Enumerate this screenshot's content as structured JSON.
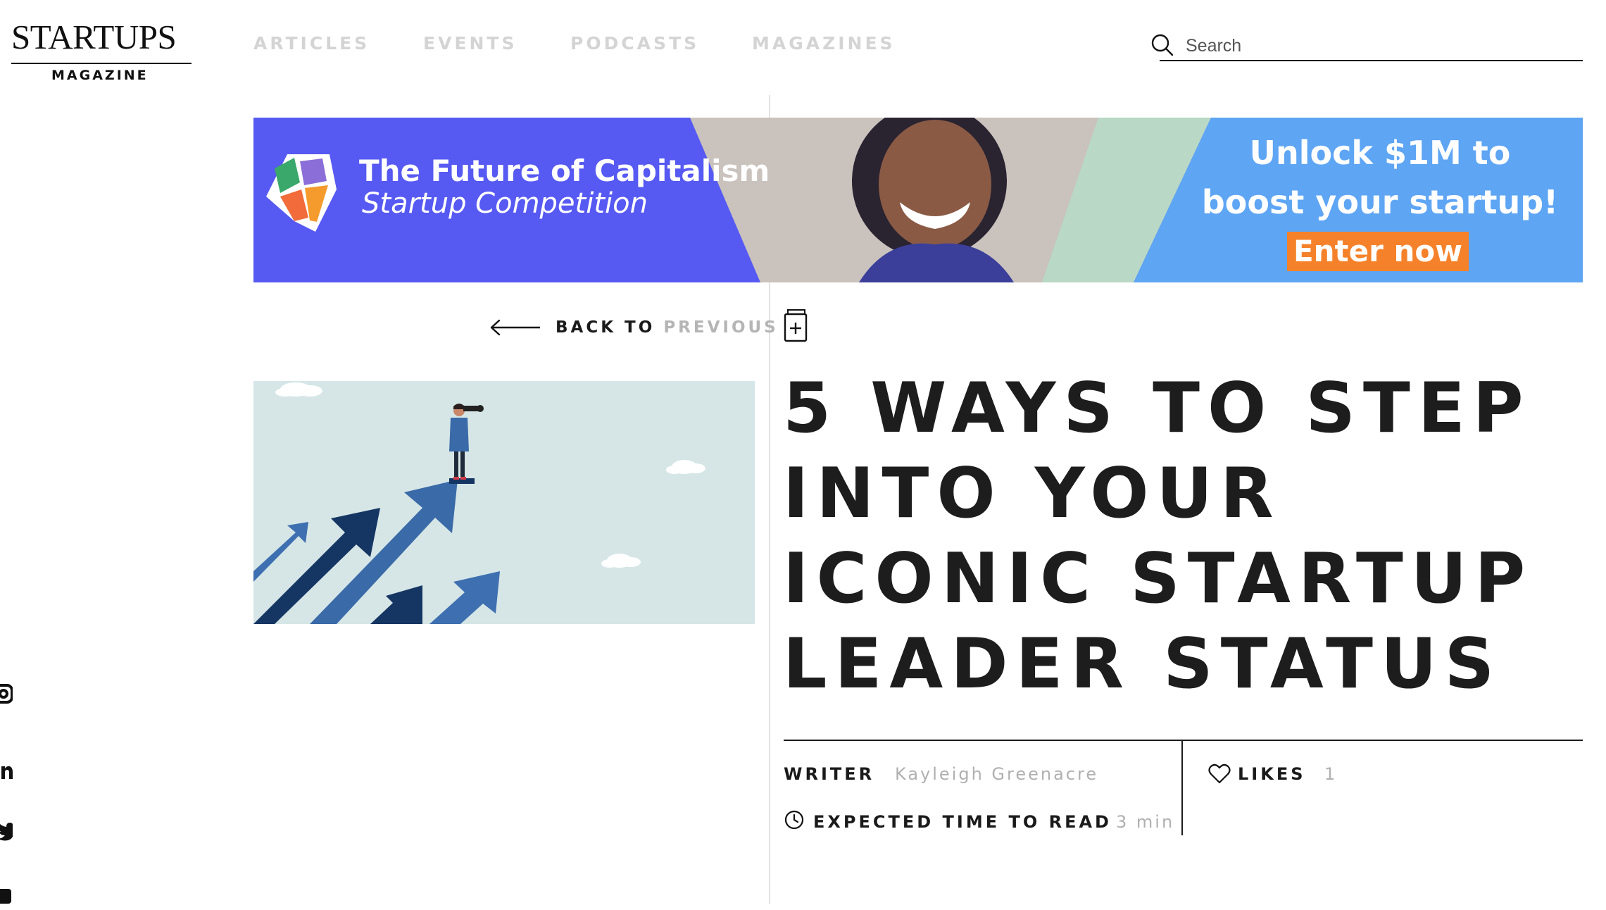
{
  "logo": {
    "top": "STARTUPS",
    "bottom": "MAGAZINE"
  },
  "nav": {
    "items": [
      "ARTICLES",
      "EVENTS",
      "PODCASTS",
      "MAGAZINES"
    ]
  },
  "search": {
    "placeholder": "Search"
  },
  "banner": {
    "title": "The Future of Capitalism",
    "subtitle": "Startup Competition",
    "cta_line1": "Unlock $1M to",
    "cta_line2": "boost your startup!",
    "button": "Enter now",
    "colors": {
      "left": "#5659f2",
      "right": "#5ea5f4",
      "button": "#f5822a"
    }
  },
  "back": {
    "prefix": "BACK TO",
    "target": "PREVIOUS"
  },
  "article": {
    "title": "5 WAYS TO STEP INTO YOUR ICONIC STARTUP LEADER STATUS",
    "writer_label": "WRITER",
    "writer": "Kayleigh Greenacre",
    "likes_label": "LIKES",
    "likes": "1",
    "read_label": "EXPECTED TIME TO READ",
    "read_time": "3 min"
  },
  "icons": [
    "search-icon",
    "arrow-left-icon",
    "add-bookmark-icon",
    "heart-icon",
    "clock-icon",
    "instagram-icon",
    "linkedin-icon",
    "twitter-icon"
  ]
}
